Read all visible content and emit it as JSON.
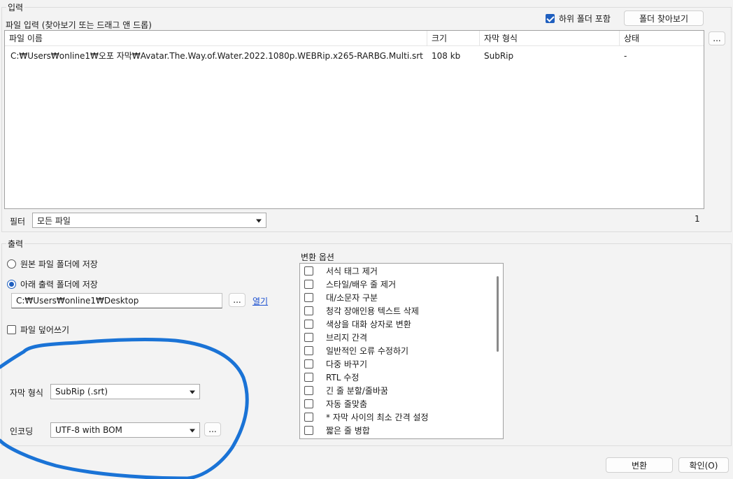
{
  "input": {
    "group_title": "입력",
    "file_input_label": "파일 입력 (찾아보기 또는 드래그 앤 드롭)",
    "include_subfolders_label": "하위 폴더 포함",
    "include_subfolders_checked": true,
    "browse_folder_button": "폴더 찾아보기",
    "more_button": "...",
    "columns": [
      "파일 이름",
      "크기",
      "자막 형식",
      "상태"
    ],
    "files": [
      {
        "name": "C:₩Users₩online1₩오포 자막₩Avatar.The.Way.of.Water.2022.1080p.WEBRip.x265-RARBG.Multi.srt",
        "size": "108 kb",
        "format": "SubRip",
        "status": "-"
      }
    ],
    "filter_label": "필터",
    "filter_value": "모든 파일",
    "count": "1"
  },
  "output": {
    "group_title": "출력",
    "radio_source_folder": "원본 파일 폴더에 저장",
    "radio_output_folder": "아래 출력 폴더에 저장",
    "selected_radio": "output_folder",
    "output_path": "C:₩Users₩online1₩Desktop",
    "browse_button": "...",
    "open_link": "열기",
    "overwrite_label": "파일 덮어쓰기",
    "overwrite_checked": false,
    "subtitle_format_label": "자막 형식",
    "subtitle_format_value": "SubRip (.srt)",
    "encoding_label": "인코딩",
    "encoding_value": "UTF-8 with BOM",
    "encoding_more_button": "..."
  },
  "conversion_options": {
    "title": "변환 옵션",
    "items": [
      "서식 태그 제거",
      "스타일/배우 줄 제거",
      "대/소문자 구분",
      "청각 장애인용 텍스트 삭제",
      "색상을 대화 상자로 변환",
      "브리지 간격",
      "일반적인 오류 수정하기",
      "다중 바꾸기",
      "RTL 수정",
      "긴 줄 분할/줄바꿈",
      "자동 줄맞춤",
      "* 자막 사이의 최소 간격 설정",
      "짧은 줄 병합"
    ]
  },
  "footer": {
    "convert_button": "변환",
    "ok_button": "확인(O)"
  },
  "annotation": {
    "color": "#1a73d6"
  }
}
